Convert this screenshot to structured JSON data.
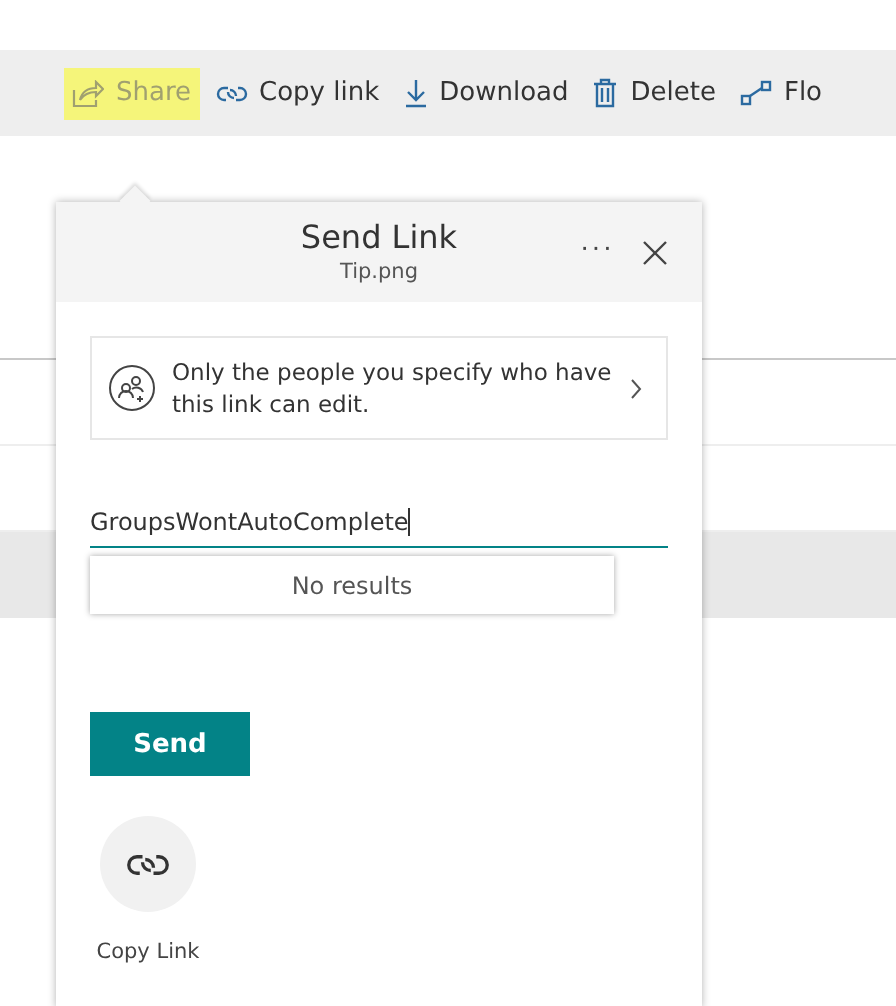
{
  "toolbar": {
    "items": [
      {
        "kind": "share",
        "label": "Share",
        "highlighted": true
      },
      {
        "kind": "link",
        "label": "Copy link",
        "highlighted": false
      },
      {
        "kind": "download",
        "label": "Download",
        "highlighted": false
      },
      {
        "kind": "delete",
        "label": "Delete",
        "highlighted": false
      },
      {
        "kind": "flow",
        "label": "Flo",
        "highlighted": false
      }
    ]
  },
  "dialog": {
    "title": "Send Link",
    "subtitle": "Tip.png",
    "more": "···",
    "permission": "Only the people you specify who have this link can edit.",
    "recipient": {
      "value": "GroupsWontAutoComplete"
    },
    "suggestions": {
      "message": "No results"
    },
    "send": "Send",
    "actions": [
      {
        "kind": "link",
        "label": "Copy Link"
      }
    ]
  }
}
